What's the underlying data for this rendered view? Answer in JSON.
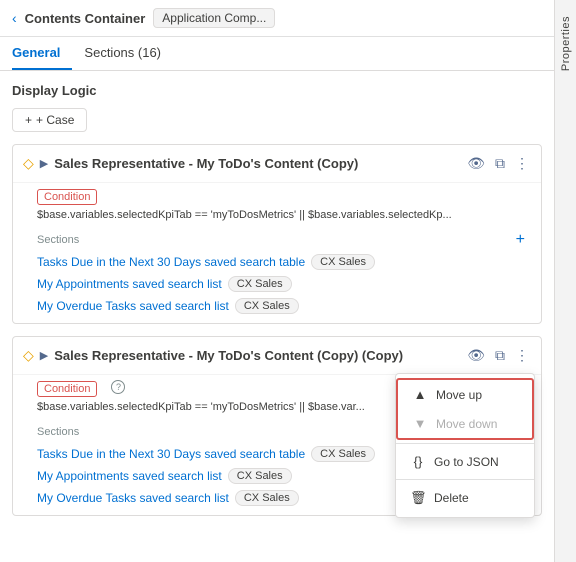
{
  "header": {
    "back_label": "‹",
    "title": "Contents Container",
    "badge": "Application Comp..."
  },
  "tabs": [
    {
      "label": "General",
      "active": true
    },
    {
      "label": "Sections (16)",
      "active": false
    }
  ],
  "display_logic": {
    "title": "Display Logic",
    "add_case_label": "+ Case"
  },
  "cases": [
    {
      "id": "case1",
      "name": "Sales Representative - My ToDo's Content (Copy)",
      "condition_label": "Condition",
      "condition_value": "$base.variables.selectedKpiTab == 'myToDosMetrics' || $base.variables.selectedKp...",
      "sections_label": "Sections",
      "sections": [
        {
          "name": "Tasks Due in the Next 30 Days saved search table",
          "tag": "CX Sales"
        },
        {
          "name": "My Appointments saved search list",
          "tag": "CX Sales"
        },
        {
          "name": "My Overdue Tasks saved search list",
          "tag": "CX Sales"
        }
      ],
      "has_help": false,
      "show_menu": false
    },
    {
      "id": "case2",
      "name": "Sales Representative - My ToDo's Content (Copy) (Copy)",
      "condition_label": "Condition",
      "condition_value": "$base.variables.selectedKpiTab == 'myToDosMetrics' || $base.var...",
      "sections_label": "Sections",
      "sections": [
        {
          "name": "Tasks Due in the Next 30 Days saved search table",
          "tag": "CX Sales"
        },
        {
          "name": "My Appointments saved search list",
          "tag": "CX Sales"
        },
        {
          "name": "My Overdue Tasks saved search list",
          "tag": "CX Sales"
        }
      ],
      "has_help": true,
      "show_menu": true
    }
  ],
  "context_menu": {
    "items": [
      {
        "label": "Move up",
        "icon": "▲",
        "disabled": false
      },
      {
        "label": "Move down",
        "icon": "▼",
        "disabled": true
      },
      {
        "label": "Go to JSON",
        "icon": "{}",
        "disabled": false
      },
      {
        "label": "Delete",
        "icon": "🗑",
        "disabled": false
      }
    ]
  },
  "properties_sidebar": {
    "label": "Properties"
  }
}
